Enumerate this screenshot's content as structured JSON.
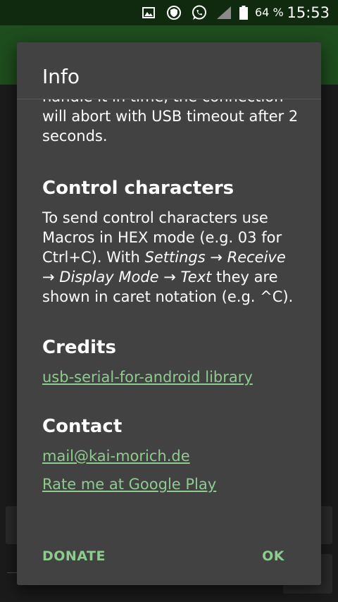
{
  "status_bar": {
    "battery": "64 %",
    "time": "15:53",
    "icons": [
      "image-icon",
      "shield-icon",
      "whatsapp-icon",
      "signal-icon",
      "battery-icon"
    ]
  },
  "dialog": {
    "title": "Info",
    "clipped_text_top": "handle it in time, the connection",
    "intro_text_rest": "will abort with USB timeout after 2 seconds.",
    "sections": {
      "control": {
        "heading": "Control characters",
        "text_a": "To send control characters use Macros in HEX mode (e.g. 03 for Ctrl+C). With ",
        "text_settings": "Settings",
        "arrow1": " → ",
        "text_receive": "Receive",
        "arrow2": " → ",
        "text_display_mode": "Display Mode",
        "arrow3": " → ",
        "text_text": "Text",
        "text_b": " they are shown in caret notation (e.g. ^C)."
      },
      "credits": {
        "heading": "Credits",
        "link": "usb-serial-for-android library"
      },
      "contact": {
        "heading": "Contact",
        "email": "mail@kai-morich.de",
        "rate": "Rate me at Google Play"
      }
    },
    "actions": {
      "donate": "DONATE",
      "ok": "OK"
    }
  },
  "colors": {
    "dialog_bg": "#424242",
    "accent": "#8ecb8e",
    "toolbar": "#1e4d1e",
    "status_bar": "#0f2a0f"
  }
}
